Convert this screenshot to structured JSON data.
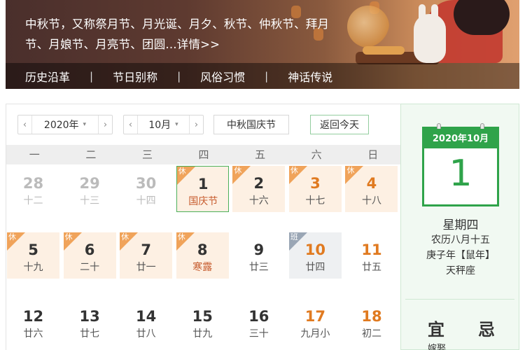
{
  "banner": {
    "description": "中秋节，又称祭月节、月光诞、月夕、秋节、仲秋节、拜月节、月娘节、月亮节、团圆...",
    "details_link": "详情>>",
    "nav": [
      "历史沿革",
      "节日别称",
      "风俗习惯",
      "神话传说"
    ],
    "nav_separator": "|"
  },
  "toolbar": {
    "prev_arrow": "‹",
    "next_arrow": "›",
    "caret": "▾",
    "year_value": "2020年",
    "month_value": "10月",
    "holiday_value": "中秋国庆节",
    "today_label": "返回今天"
  },
  "weekdays": [
    "一",
    "二",
    "三",
    "四",
    "五",
    "六",
    "日"
  ],
  "days": [
    {
      "num": "28",
      "lunar": "十二",
      "other": true
    },
    {
      "num": "29",
      "lunar": "十三",
      "other": true
    },
    {
      "num": "30",
      "lunar": "十四",
      "other": true
    },
    {
      "num": "1",
      "lunar": "国庆节",
      "badge": "休",
      "festival": true,
      "selected": true
    },
    {
      "num": "2",
      "lunar": "十六",
      "badge": "休"
    },
    {
      "num": "3",
      "lunar": "十七",
      "badge": "休",
      "weekend": true
    },
    {
      "num": "4",
      "lunar": "十八",
      "badge": "休",
      "weekend": true
    },
    {
      "num": "5",
      "lunar": "十九",
      "badge": "休"
    },
    {
      "num": "6",
      "lunar": "二十",
      "badge": "休"
    },
    {
      "num": "7",
      "lunar": "廿一",
      "badge": "休"
    },
    {
      "num": "8",
      "lunar": "寒露",
      "badge": "休",
      "festival": true
    },
    {
      "num": "9",
      "lunar": "廿三"
    },
    {
      "num": "10",
      "lunar": "廿四",
      "badge": "班",
      "workday": true,
      "weekend": true
    },
    {
      "num": "11",
      "lunar": "廿五",
      "weekend": true
    },
    {
      "num": "12",
      "lunar": "廿六"
    },
    {
      "num": "13",
      "lunar": "廿七"
    },
    {
      "num": "14",
      "lunar": "廿八"
    },
    {
      "num": "15",
      "lunar": "廿九"
    },
    {
      "num": "16",
      "lunar": "三十"
    },
    {
      "num": "17",
      "lunar": "九月小",
      "weekend": true
    },
    {
      "num": "18",
      "lunar": "初二",
      "weekend": true
    }
  ],
  "side": {
    "card_header": "2020年10月",
    "day": "1",
    "weekday": "星期四",
    "lunar": "农历八月十五",
    "ganzhi": "庚子年【鼠年】",
    "zodiac": "天秤座",
    "yi": "宜",
    "ji": "忌",
    "yi_first_item": "嫁娶"
  },
  "colors": {
    "accent_green": "#2fa34a",
    "holiday_bg": "#fdf0e3",
    "holiday_badge": "#f0a35a",
    "weekend_text": "#e07a20",
    "workday_badge": "#9aa6b5"
  }
}
